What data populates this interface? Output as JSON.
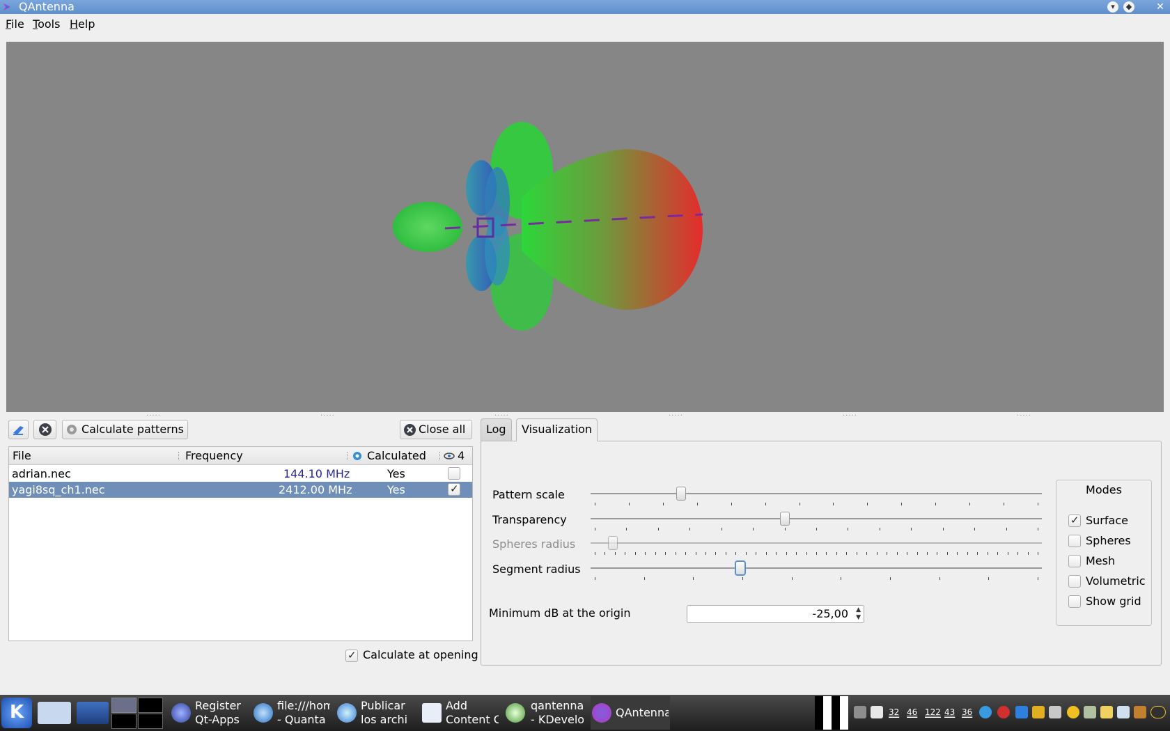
{
  "window": {
    "title": "QAntenna",
    "controls": [
      "minimize-icon",
      "maximize-icon",
      "close-icon"
    ]
  },
  "menubar": {
    "items": [
      {
        "key": "F",
        "rest": "ile"
      },
      {
        "key": "T",
        "rest": "ools"
      },
      {
        "key": "H",
        "rest": "elp"
      }
    ]
  },
  "viewport": {
    "background": "#868686",
    "icon": "radiation-pattern-3d"
  },
  "toolbar": {
    "open_icon": "open-file-icon",
    "remove_icon": "remove-icon",
    "calculate_label": "Calculate patterns",
    "close_all_label": "Close all"
  },
  "file_table": {
    "headers": {
      "file": "File",
      "frequency": "Frequency",
      "calculated": "Calculated",
      "visible_count": "4"
    },
    "rows": [
      {
        "file": "adrian.nec",
        "frequency": "144.10 MHz",
        "calculated": "Yes",
        "visible": false,
        "selected": false
      },
      {
        "file": "yagi8sq_ch1.nec",
        "frequency": "2412.00 MHz",
        "calculated": "Yes",
        "visible": true,
        "selected": true
      }
    ],
    "selection_color": "#6f8fb8"
  },
  "calculate_at_opening": {
    "label": "Calculate at opening",
    "checked": true
  },
  "tabs": [
    {
      "label": "Log",
      "active": false
    },
    {
      "label": "Visualization",
      "active": true
    }
  ],
  "visualization": {
    "sliders": [
      {
        "label": "Pattern scale",
        "value": 0.2,
        "enabled": true
      },
      {
        "label": "Transparency",
        "value": 0.43,
        "enabled": true
      },
      {
        "label": "Spheres radius",
        "value": 0.05,
        "enabled": false
      },
      {
        "label": "Segment radius",
        "value": 0.33,
        "enabled": true
      }
    ],
    "min_db": {
      "label": "Minimum dB at the origin",
      "value": "-25,00"
    },
    "modes": {
      "title": "Modes",
      "items": [
        {
          "label": "Surface",
          "checked": true
        },
        {
          "label": "Spheres",
          "checked": false
        },
        {
          "label": "Mesh",
          "checked": false
        },
        {
          "label": "Volumetric",
          "checked": false
        },
        {
          "label": "Show grid",
          "checked": false
        }
      ]
    }
  },
  "taskbar": {
    "items": [
      {
        "line1": "Register",
        "line2": "Qt-Apps",
        "icon": "browser-icon"
      },
      {
        "line1": "file:///hom",
        "line2": "- Quanta",
        "icon": "quanta-icon"
      },
      {
        "line1": "Publicar",
        "line2": "los archi",
        "icon": "konqueror-icon"
      },
      {
        "line1": "Add",
        "line2": "Content C",
        "icon": "document-icon"
      },
      {
        "line1": "qantenna",
        "line2": "- KDevelo",
        "icon": "kdevelop-icon"
      },
      {
        "line1": "QAntenna",
        "line2": "",
        "icon": "qantenna-icon",
        "active": true
      }
    ],
    "tray_numbers": [
      "32",
      "46",
      "122",
      "43",
      "36"
    ]
  }
}
